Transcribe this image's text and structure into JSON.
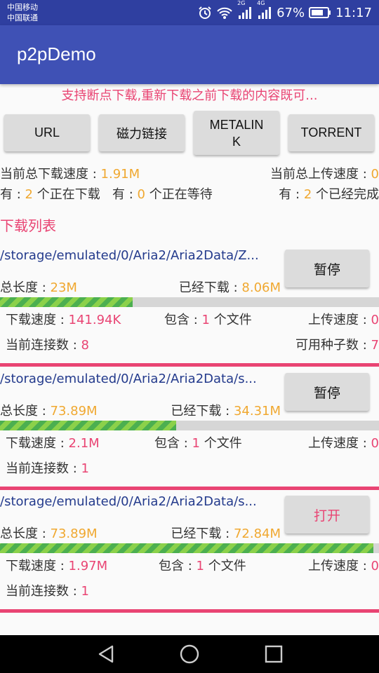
{
  "status_bar": {
    "carrier1": "中国移动",
    "carrier2": "中国联通",
    "net1": "2G",
    "net2": "4G",
    "battery": "67%",
    "time": "11:17"
  },
  "app": {
    "title": "p2pDemo"
  },
  "notice": "支持断点下载,重新下载之前下载的内容既可...",
  "buttons": {
    "url": "URL",
    "magnet": "磁力链接",
    "metalink_1": "METALIN",
    "metalink_2": "K",
    "torrent": "TORRENT"
  },
  "summary": {
    "download_speed_label": "当前总下载速度 : ",
    "download_speed": "1.91M",
    "upload_speed_label": "当前总上传速度 : ",
    "upload_speed": "0",
    "has_label": "有 : ",
    "downloading_count": "2",
    "downloading_label": " 个正在下载",
    "has_label2": "有 : ",
    "waiting_count": "0",
    "waiting_label": " 个正在等待",
    "has_label3": "有 : ",
    "completed_count": "2",
    "completed_label": " 个已经完成"
  },
  "list_title": "下载列表",
  "labels": {
    "total": "总长度 : ",
    "downloaded": "已经下载 : ",
    "speed": "下载速度 : ",
    "contains": "包含 : ",
    "files_unit": " 个文件",
    "upload": "上传速度 : ",
    "connections": "当前连接数 : ",
    "seeders": "可用种子数 : "
  },
  "items": [
    {
      "path": "/storage/emulated/0/Aria2/Aria2Data/Z...",
      "button": "暂停",
      "total": "23M",
      "downloaded": "8.06M",
      "progress": 0.35,
      "speed": "141.94K",
      "files": "1",
      "upload": "0",
      "connections": "8",
      "seeders": "7"
    },
    {
      "path": "/storage/emulated/0/Aria2/Aria2Data/s...",
      "button": "暂停",
      "total": "73.89M",
      "downloaded": "34.31M",
      "progress": 0.464,
      "speed": "2.1M",
      "files": "1",
      "upload": "0",
      "connections": "1"
    },
    {
      "path": "/storage/emulated/0/Aria2/Aria2Data/s...",
      "button": "打开",
      "total": "73.89M",
      "downloaded": "72.84M",
      "progress": 0.986,
      "speed": "1.97M",
      "files": "1",
      "upload": "0",
      "connections": "1"
    }
  ]
}
